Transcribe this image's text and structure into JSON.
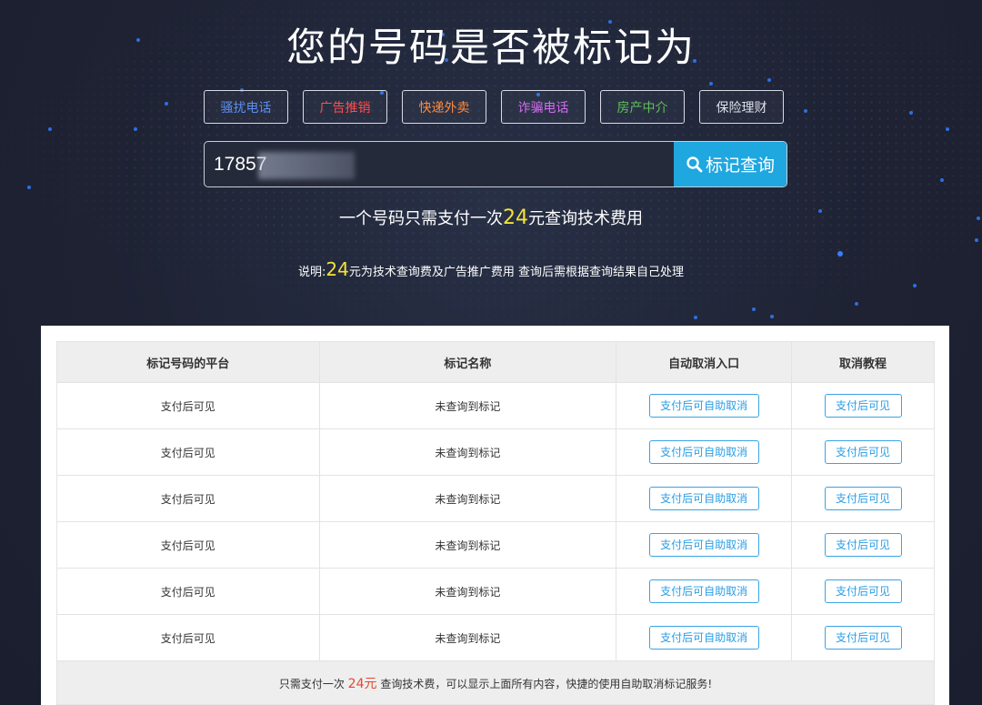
{
  "title": "您的号码是否被标记为",
  "tags": [
    {
      "label": "骚扰电话",
      "color": "#5b8ff0"
    },
    {
      "label": "广告推销",
      "color": "#ff4d4d"
    },
    {
      "label": "快递外卖",
      "color": "#ff8a3d"
    },
    {
      "label": "诈骗电话",
      "color": "#d46cf0"
    },
    {
      "label": "房产中介",
      "color": "#5fbf5a"
    },
    {
      "label": "保险理财",
      "color": "#dfe2ea"
    }
  ],
  "search": {
    "value": "17857",
    "button_label": "标记查询"
  },
  "price_line": {
    "before": "一个号码只需支付一次",
    "amount": "24",
    "after": "元查询技术费用"
  },
  "note": {
    "before": "说明:",
    "amount": "24",
    "after": "元为技术查询费及广告推广费用 查询后需根据查询结果自己处理"
  },
  "table": {
    "headers": [
      "标记号码的平台",
      "标记名称",
      "自动取消入口",
      "取消教程"
    ],
    "rows": [
      {
        "platform": "支付后可见",
        "name": "未查询到标记",
        "cancel": "支付后可自助取消",
        "tutorial": "支付后可见"
      },
      {
        "platform": "支付后可见",
        "name": "未查询到标记",
        "cancel": "支付后可自助取消",
        "tutorial": "支付后可见"
      },
      {
        "platform": "支付后可见",
        "name": "未查询到标记",
        "cancel": "支付后可自助取消",
        "tutorial": "支付后可见"
      },
      {
        "platform": "支付后可见",
        "name": "未查询到标记",
        "cancel": "支付后可自助取消",
        "tutorial": "支付后可见"
      },
      {
        "platform": "支付后可见",
        "name": "未查询到标记",
        "cancel": "支付后可自助取消",
        "tutorial": "支付后可见"
      },
      {
        "platform": "支付后可见",
        "name": "未查询到标记",
        "cancel": "支付后可自助取消",
        "tutorial": "支付后可见"
      }
    ],
    "footer": {
      "before": "只需支付一次 ",
      "amount": "24元",
      "after": " 查询技术费，可以显示上面所有内容，快捷的使用自助取消标记服务!"
    }
  },
  "colors": {
    "accent": "#1fa7e0",
    "highlight": "#f3e23a",
    "price_red": "#e8452c"
  }
}
